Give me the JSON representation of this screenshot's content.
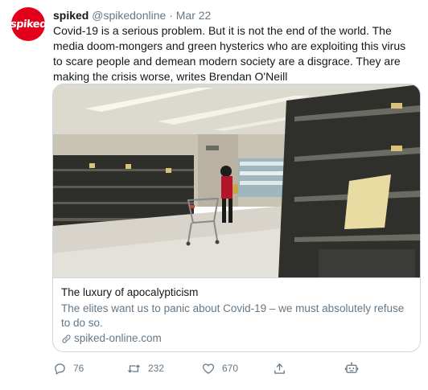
{
  "tweet": {
    "avatar_text": "spiked",
    "name": "spiked",
    "handle": "@spikedonline",
    "separator": "·",
    "date": "Mar 22",
    "text": "Covid-19 is a serious problem. But it is not the end of the world. The media doom-mongers and green hysterics who are exploiting this virus to scare people and demean modern society are a disgrace. They are making the crisis worse, writes Brendan O'Neill"
  },
  "card": {
    "title": "The luxury of apocalypticism",
    "description": "The elites want us to panic about Covid-19 – we must absolutely refuse to do so.",
    "domain": "spiked-online.com"
  },
  "actions": {
    "replies": "76",
    "retweets": "232",
    "likes": "670"
  },
  "colors": {
    "brand": "#e2001a",
    "secondary_text": "#657786",
    "border": "#ccd6dd"
  },
  "icons": [
    "reply-icon",
    "retweet-icon",
    "like-icon",
    "share-icon",
    "analytics-icon",
    "link-icon"
  ]
}
